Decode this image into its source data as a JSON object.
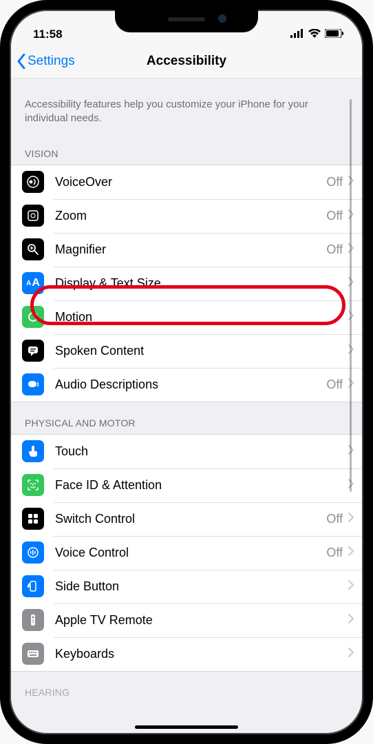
{
  "status": {
    "time": "11:58"
  },
  "nav": {
    "back_label": "Settings",
    "title": "Accessibility"
  },
  "intro": "Accessibility features help you customize your iPhone for your individual needs.",
  "sections": {
    "vision": {
      "header": "VISION",
      "items": [
        {
          "label": "VoiceOver",
          "detail": "Off",
          "icon": "voiceover",
          "bg": "#000000"
        },
        {
          "label": "Zoom",
          "detail": "Off",
          "icon": "zoom",
          "bg": "#000000"
        },
        {
          "label": "Magnifier",
          "detail": "Off",
          "icon": "magnifier",
          "bg": "#000000"
        },
        {
          "label": "Display & Text Size",
          "detail": "",
          "icon": "text-size",
          "bg": "#007aff",
          "highlight": true
        },
        {
          "label": "Motion",
          "detail": "",
          "icon": "motion",
          "bg": "#34c759"
        },
        {
          "label": "Spoken Content",
          "detail": "",
          "icon": "spoken",
          "bg": "#000000"
        },
        {
          "label": "Audio Descriptions",
          "detail": "Off",
          "icon": "audio-desc",
          "bg": "#007aff"
        }
      ]
    },
    "motor": {
      "header": "PHYSICAL AND MOTOR",
      "items": [
        {
          "label": "Touch",
          "detail": "",
          "icon": "touch",
          "bg": "#007aff"
        },
        {
          "label": "Face ID & Attention",
          "detail": "",
          "icon": "faceid",
          "bg": "#34c759"
        },
        {
          "label": "Switch Control",
          "detail": "Off",
          "icon": "switch",
          "bg": "#000000"
        },
        {
          "label": "Voice Control",
          "detail": "Off",
          "icon": "voice-ctrl",
          "bg": "#007aff"
        },
        {
          "label": "Side Button",
          "detail": "",
          "icon": "side-btn",
          "bg": "#007aff"
        },
        {
          "label": "Apple TV Remote",
          "detail": "",
          "icon": "tv-remote",
          "bg": "#8e8e93"
        },
        {
          "label": "Keyboards",
          "detail": "",
          "icon": "keyboard",
          "bg": "#8e8e93"
        }
      ]
    },
    "hearing": {
      "header": "HEARING"
    }
  }
}
